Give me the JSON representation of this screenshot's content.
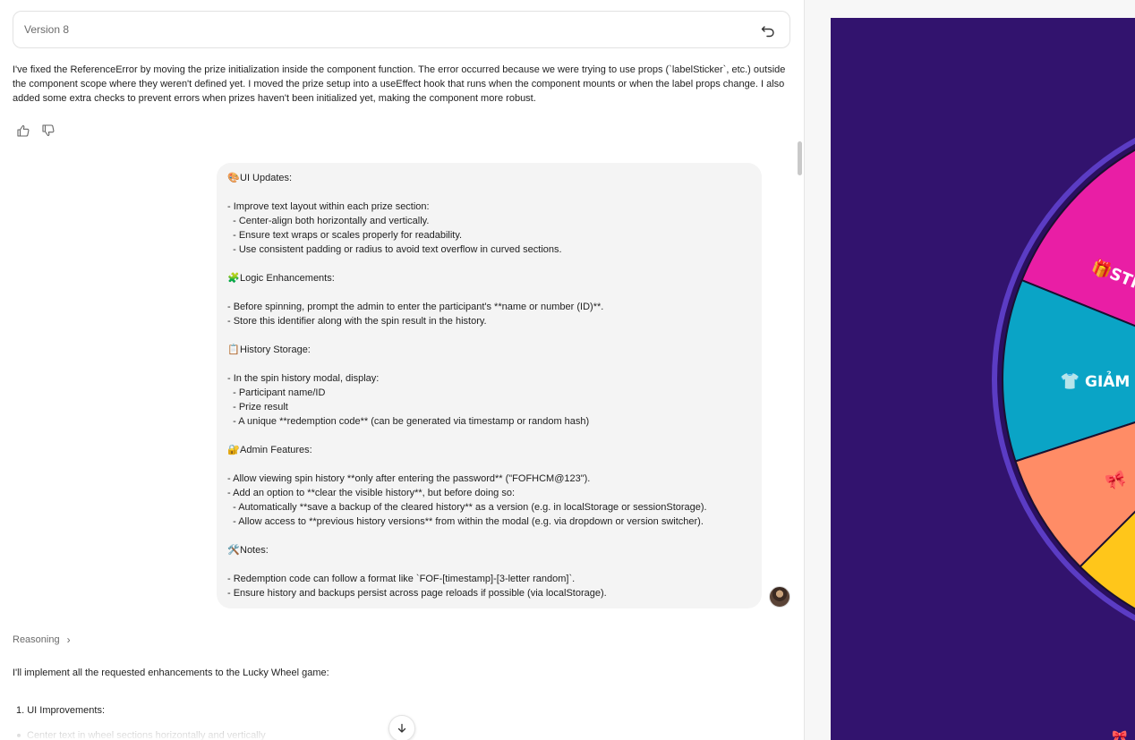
{
  "header": {
    "version_label": "Version 8",
    "revert_icon": "undo-icon"
  },
  "assistant_message": {
    "text": "I've fixed the ReferenceError by moving the prize initialization inside the component function. The error occurred because we were trying to use props (`labelSticker`, etc.) outside the component scope where they weren't defined yet. I moved the prize setup into a useEffect hook that runs when the component mounts or when the label props change. I also added some extra checks to prevent errors when prizes haven't been initialized yet, making the component more robust."
  },
  "feedback": {
    "like_icon": "thumbs-up-icon",
    "dislike_icon": "thumbs-down-icon"
  },
  "user_message": {
    "lines": [
      {
        "emoji": "🎨",
        "text": "UI Updates:"
      },
      {
        "emoji": "",
        "text": ""
      },
      {
        "emoji": "",
        "text": "- Improve text layout within each prize section:"
      },
      {
        "emoji": "",
        "text": "  - Center-align both horizontally and vertically."
      },
      {
        "emoji": "",
        "text": "  - Ensure text wraps or scales properly for readability."
      },
      {
        "emoji": "",
        "text": "  - Use consistent padding or radius to avoid text overflow in curved sections."
      },
      {
        "emoji": "",
        "text": ""
      },
      {
        "emoji": "🧩",
        "text": "Logic Enhancements:"
      },
      {
        "emoji": "",
        "text": ""
      },
      {
        "emoji": "",
        "text": "- Before spinning, prompt the admin to enter the participant's **name or number (ID)**."
      },
      {
        "emoji": "",
        "text": "- Store this identifier along with the spin result in the history."
      },
      {
        "emoji": "",
        "text": ""
      },
      {
        "emoji": "📋",
        "text": "History Storage:"
      },
      {
        "emoji": "",
        "text": ""
      },
      {
        "emoji": "",
        "text": "- In the spin history modal, display:"
      },
      {
        "emoji": "",
        "text": "  - Participant name/ID"
      },
      {
        "emoji": "",
        "text": "  - Prize result"
      },
      {
        "emoji": "",
        "text": "  - A unique **redemption code** (can be generated via timestamp or random hash)"
      },
      {
        "emoji": "",
        "text": ""
      },
      {
        "emoji": "🔐",
        "text": "Admin Features:"
      },
      {
        "emoji": "",
        "text": ""
      },
      {
        "emoji": "",
        "text": "- Allow viewing spin history **only after entering the password** (\"FOFHCM@123\")."
      },
      {
        "emoji": "",
        "text": "- Add an option to **clear the visible history**, but before doing so:"
      },
      {
        "emoji": "",
        "text": "  - Automatically **save a backup of the cleared history** as a version (e.g. in localStorage or sessionStorage)."
      },
      {
        "emoji": "",
        "text": "  - Allow access to **previous history versions** from within the modal (e.g. via dropdown or version switcher)."
      },
      {
        "emoji": "",
        "text": ""
      },
      {
        "emoji": "🛠️",
        "text": "Notes:"
      },
      {
        "emoji": "",
        "text": ""
      },
      {
        "emoji": "",
        "text": "- Redemption code can follow a format like `FOF-[timestamp]-[3-letter random]`."
      },
      {
        "emoji": "",
        "text": "- Ensure history and backups persist across page reloads if possible (via localStorage)."
      }
    ],
    "avatar_icon": "user-avatar"
  },
  "reasoning": {
    "label": "Reasoning",
    "icon": "chevron-right-icon"
  },
  "reply": {
    "intro": "I'll implement all the requested enhancements to the Lucky Wheel game:",
    "list_item_1": "1. UI Improvements:",
    "sub_item_1": "Center text in wheel sections horizontally and vertically"
  },
  "scroll_down_icon": "arrow-down-icon",
  "preview": {
    "background_color": "#32136e",
    "wheel_labels": {
      "sticker": "STICKER",
      "discount": "GIẢM"
    },
    "segment_colors": [
      "#a8e6cf",
      "#e91ea5",
      "#0aa4c6",
      "#ff8c66",
      "#ffc61a"
    ],
    "rim_color": "#5b3cc4"
  }
}
